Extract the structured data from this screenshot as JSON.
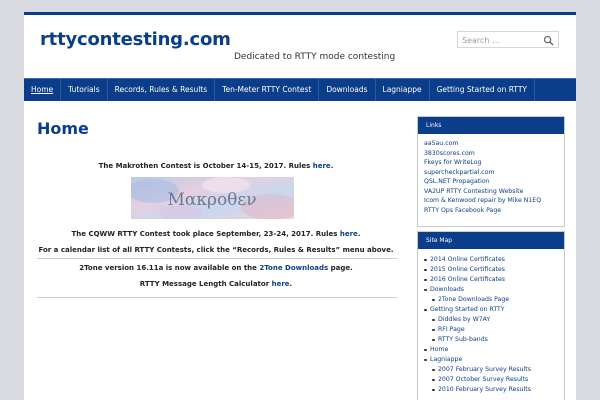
{
  "header": {
    "site_title": "rttycontesting.com",
    "tagline": "Dedicated to RTTY mode contesting",
    "search_placeholder": "Search …"
  },
  "nav": {
    "items": [
      "Home",
      "Tutorials",
      "Records, Rules & Results",
      "Ten-Meter RTTY Contest",
      "Downloads",
      "Lagniappe",
      "Getting Started on RTTY"
    ]
  },
  "main": {
    "page_title": "Home",
    "makrothen_text": "The Makrothen Contest is October 14-15, 2017. Rules ",
    "makrothen_link": "here",
    "makrothen_end": ".",
    "logo_text": "Μακροθεν",
    "cqww_text": "The CQWW RTTY Contest took place September, 23-24, 2017. Rules ",
    "cqww_link": "here",
    "cqww_end": ".",
    "calendar_text": "For a calendar list of all RTTY Contests, click the “Records, Rules & Results” menu above.",
    "twotone_text": "2Tone version 16.11a is now available on the ",
    "twotone_link": "2Tone Downloads",
    "twotone_end": " page.",
    "calc_text": "RTTY Message Length Calculator ",
    "calc_link": "here",
    "calc_end": "."
  },
  "sidebar": {
    "links_title": "Links",
    "links": [
      "aa5au.com",
      "3830scores.com",
      "Fkeys for WriteLog",
      "supercheckpartial.com",
      "QSL.NET Propagation",
      "VA2UP RTTY Contesting Website",
      "Icom & Kenwood repair by Mike N1EQ",
      "RTTY Ops Facebook Page"
    ],
    "sitemap_title": "Site Map",
    "sitemap": [
      "2014 Online Certificates",
      "2015 Online Certificates",
      "2016 Online Certificates",
      "Downloads",
      "2Tone Downloads Page",
      "Getting Started on RTTY",
      "Diddles by W7AY",
      "RFI Page",
      "RTTY Sub-bands",
      "Home",
      "Lagniappe",
      "2007 February Survey Results",
      "2007 October Survey Results",
      "2010 February Survey Results"
    ]
  },
  "colors": {
    "brand_blue": "#0b3e8a",
    "page_background": "#d9dbe0"
  }
}
